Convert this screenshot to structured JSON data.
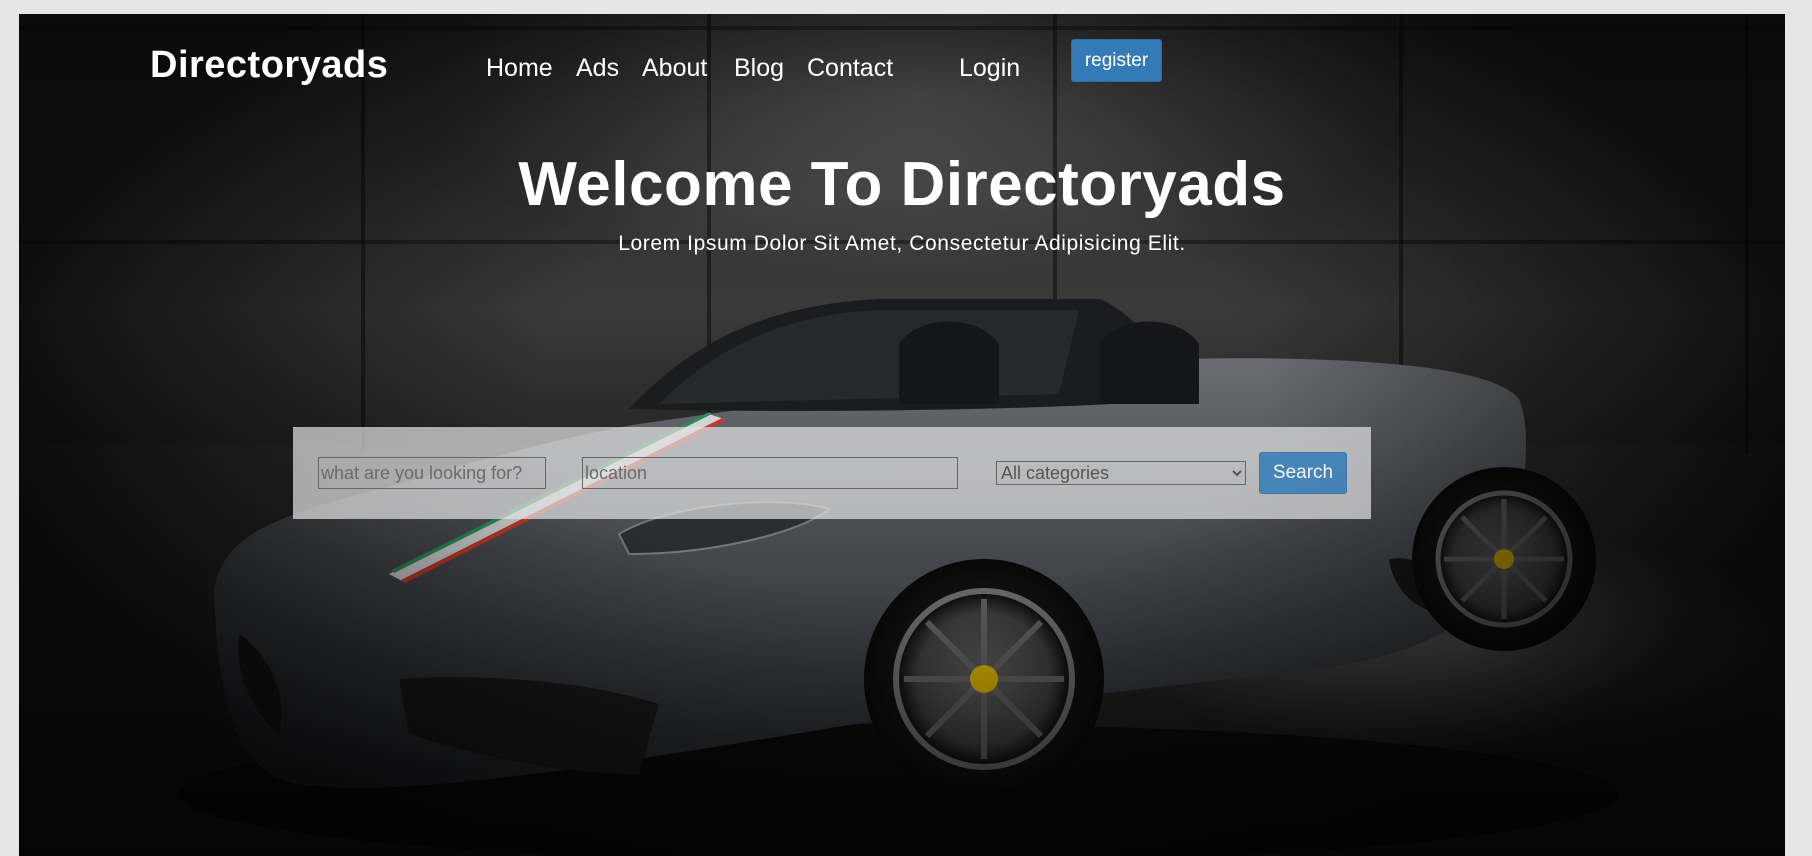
{
  "brand": "Directoryads",
  "nav": {
    "items": [
      {
        "label": "Home"
      },
      {
        "label": "Ads"
      },
      {
        "label": "About"
      },
      {
        "label": "Blog"
      },
      {
        "label": "Contact"
      }
    ],
    "login": "Login",
    "register": "register"
  },
  "hero": {
    "title": "Welcome To Directoryads",
    "subtitle": "Lorem Ipsum Dolor Sit Amet, Consectetur Adipisicing Elit."
  },
  "search": {
    "what_placeholder": "what are you looking for?",
    "location_placeholder": "location",
    "category_selected": "All categories",
    "button": "Search"
  },
  "colors": {
    "accent": "#337ab7",
    "car_body": "#3f4146",
    "background": "#1e1e1e"
  }
}
